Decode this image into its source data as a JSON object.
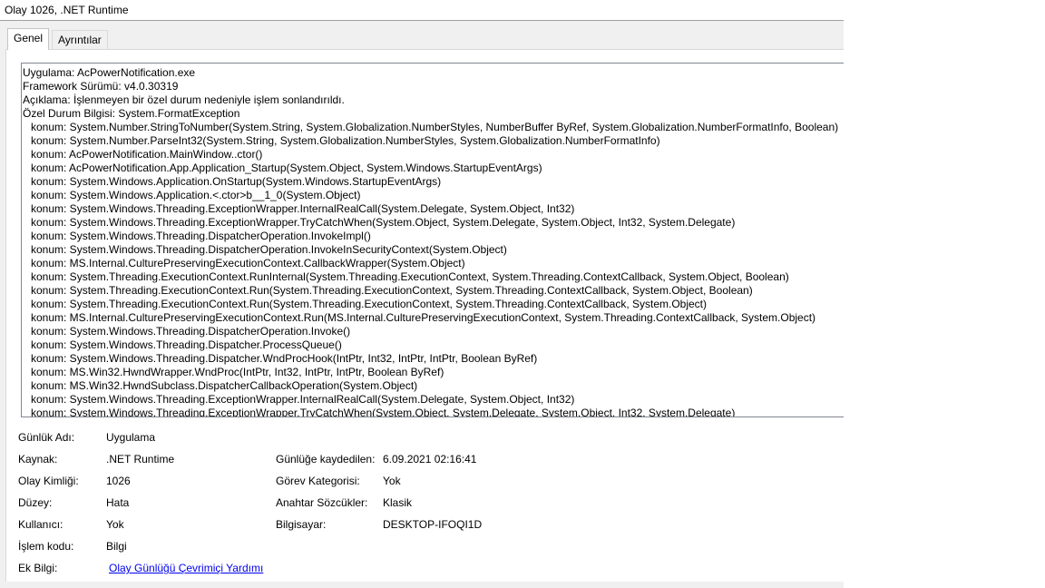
{
  "window": {
    "title": "Olay 1026, .NET Runtime"
  },
  "tabs": [
    {
      "label": "Genel",
      "active": true
    },
    {
      "label": "Ayrıntılar",
      "active": false
    }
  ],
  "description": {
    "header_lines": [
      "Uygulama: AcPowerNotification.exe",
      "Framework Sürümü: v4.0.30319",
      "Açıklama: İşlenmeyen bir özel durum nedeniyle işlem sonlandırıldı.",
      "Özel Durum Bilgisi: System.FormatException"
    ],
    "stack_lines": [
      "konum: System.Number.StringToNumber(System.String, System.Globalization.NumberStyles, NumberBuffer ByRef, System.Globalization.NumberFormatInfo, Boolean)",
      "konum: System.Number.ParseInt32(System.String, System.Globalization.NumberStyles, System.Globalization.NumberFormatInfo)",
      "konum: AcPowerNotification.MainWindow..ctor()",
      "konum: AcPowerNotification.App.Application_Startup(System.Object, System.Windows.StartupEventArgs)",
      "konum: System.Windows.Application.OnStartup(System.Windows.StartupEventArgs)",
      "konum: System.Windows.Application.<.ctor>b__1_0(System.Object)",
      "konum: System.Windows.Threading.ExceptionWrapper.InternalRealCall(System.Delegate, System.Object, Int32)",
      "konum: System.Windows.Threading.ExceptionWrapper.TryCatchWhen(System.Object, System.Delegate, System.Object, Int32, System.Delegate)",
      "konum: System.Windows.Threading.DispatcherOperation.InvokeImpl()",
      "konum: System.Windows.Threading.DispatcherOperation.InvokeInSecurityContext(System.Object)",
      "konum: MS.Internal.CulturePreservingExecutionContext.CallbackWrapper(System.Object)",
      "konum: System.Threading.ExecutionContext.RunInternal(System.Threading.ExecutionContext, System.Threading.ContextCallback, System.Object, Boolean)",
      "konum: System.Threading.ExecutionContext.Run(System.Threading.ExecutionContext, System.Threading.ContextCallback, System.Object, Boolean)",
      "konum: System.Threading.ExecutionContext.Run(System.Threading.ExecutionContext, System.Threading.ContextCallback, System.Object)",
      "konum: MS.Internal.CulturePreservingExecutionContext.Run(MS.Internal.CulturePreservingExecutionContext, System.Threading.ContextCallback, System.Object)",
      "konum: System.Windows.Threading.DispatcherOperation.Invoke()",
      "konum: System.Windows.Threading.Dispatcher.ProcessQueue()",
      "konum: System.Windows.Threading.Dispatcher.WndProcHook(IntPtr, Int32, IntPtr, IntPtr, Boolean ByRef)",
      "konum: MS.Win32.HwndWrapper.WndProc(IntPtr, Int32, IntPtr, IntPtr, Boolean ByRef)",
      "konum: MS.Win32.HwndSubclass.DispatcherCallbackOperation(System.Object)",
      "konum: System.Windows.Threading.ExceptionWrapper.InternalRealCall(System.Delegate, System.Object, Int32)",
      "konum: System.Windows.Threading.ExceptionWrapper.TryCatchWhen(System.Object, System.Delegate, System.Object, Int32, System.Delegate)"
    ]
  },
  "fields": {
    "log_name": {
      "label": "Günlük Adı:",
      "value": "Uygulama"
    },
    "source": {
      "label": "Kaynak:",
      "value": ".NET Runtime"
    },
    "logged": {
      "label": "Günlüğe kaydedilen:",
      "value": "6.09.2021 02:16:41"
    },
    "event_id": {
      "label": "Olay Kimliği:",
      "value": "1026"
    },
    "task_category": {
      "label": "Görev Kategorisi:",
      "value": "Yok"
    },
    "level": {
      "label": "Düzey:",
      "value": "Hata"
    },
    "keywords": {
      "label": "Anahtar Sözcükler:",
      "value": "Klasik"
    },
    "user": {
      "label": "Kullanıcı:",
      "value": "Yok"
    },
    "computer": {
      "label": "Bilgisayar:",
      "value": "DESKTOP-IFOQI1D"
    },
    "opcode": {
      "label": "İşlem kodu:",
      "value": "Bilgi"
    },
    "more_info": {
      "label": "Ek Bilgi:",
      "link": "Olay Günlüğü Çevrimiçi Yardımı"
    }
  }
}
